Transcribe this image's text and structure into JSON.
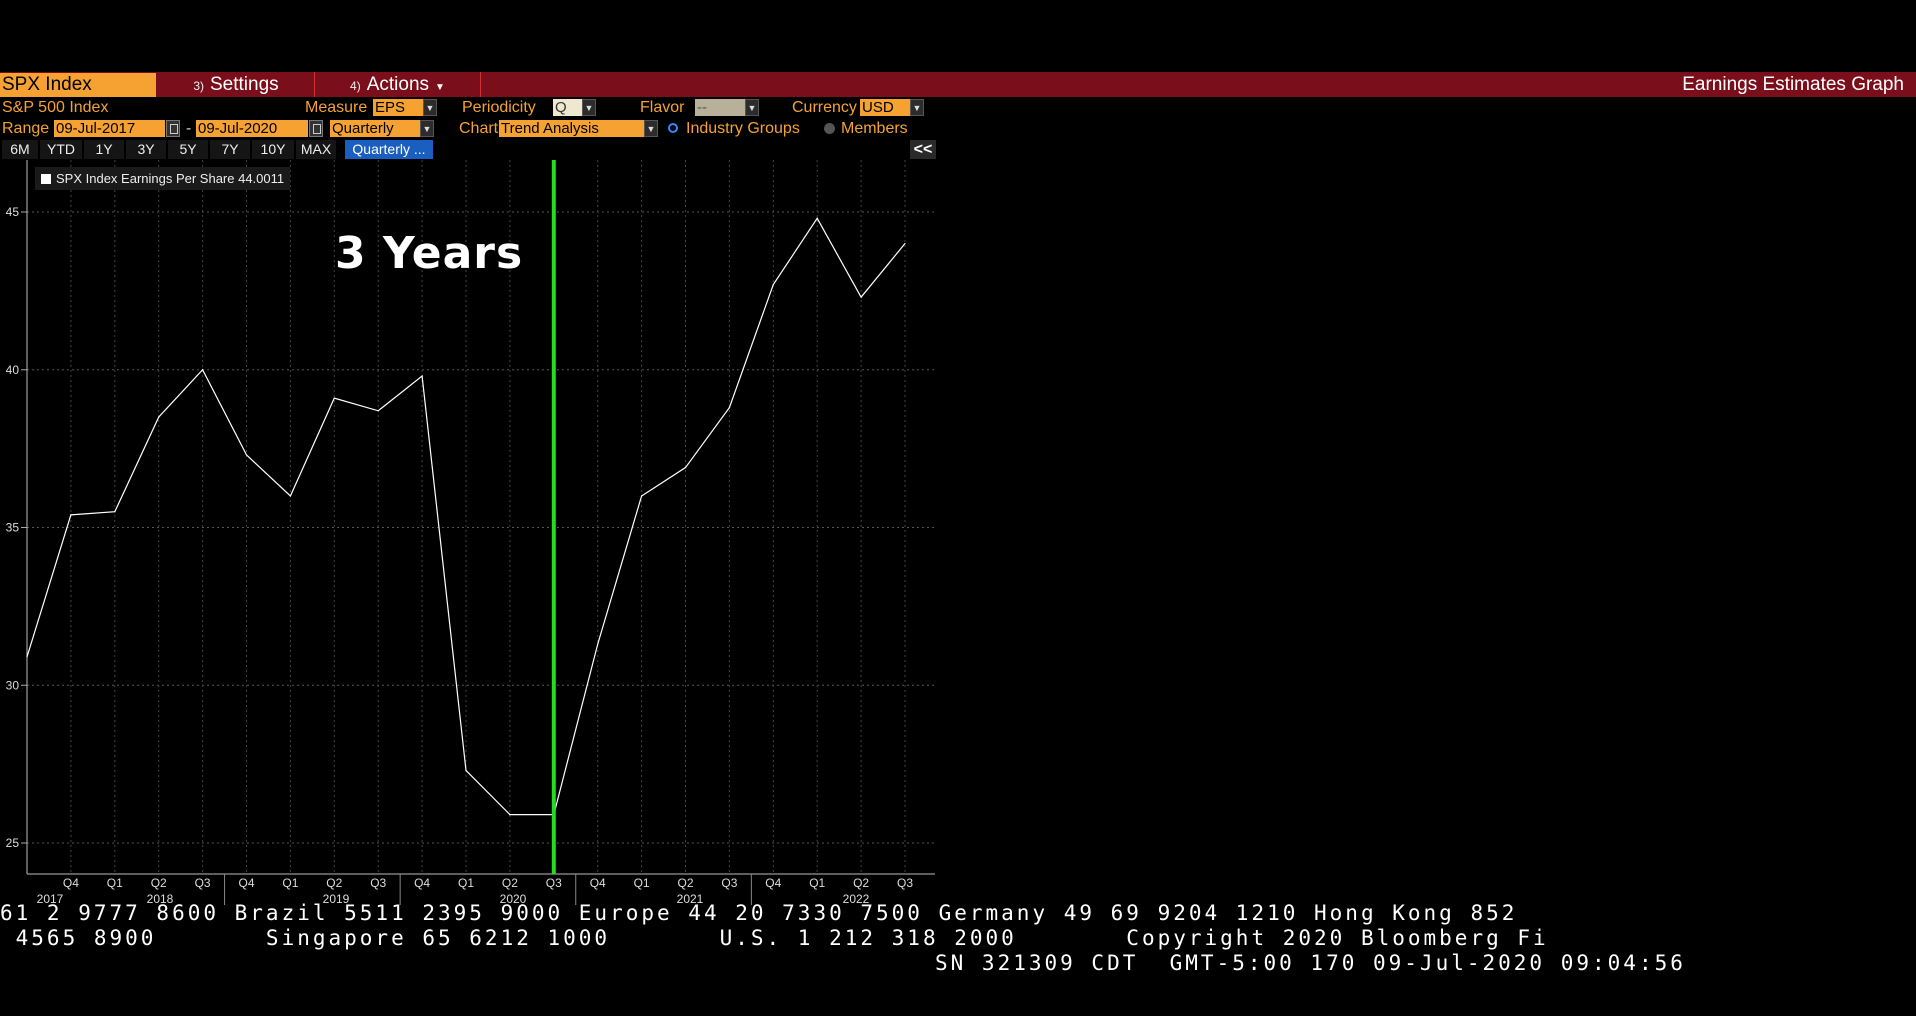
{
  "toolbar": {
    "ticker": "SPX Index",
    "settings": {
      "num": "3)",
      "label": "Settings"
    },
    "actions": {
      "num": "4)",
      "label": "Actions"
    },
    "graph_title": "Earnings Estimates Graph"
  },
  "controls": {
    "security_name": "S&P 500 Index",
    "measure_label": "Measure",
    "measure_value": "EPS",
    "periodicity_label": "Periodicity",
    "periodicity_value": "Q",
    "flavor_label": "Flavor",
    "flavor_value": "--",
    "currency_label": "Currency",
    "currency_value": "USD",
    "range_label": "Range",
    "range_start": "09-Jul-2017",
    "range_sep": "-",
    "range_end": "09-Jul-2020",
    "period_value": "Quarterly",
    "chart_label": "Chart",
    "chart_value": "Trend Analysis",
    "radio_industry": "Industry Groups",
    "radio_members": "Members"
  },
  "zoom_buttons": [
    "6M",
    "YTD",
    "1Y",
    "3Y",
    "5Y",
    "7Y",
    "10Y",
    "MAX"
  ],
  "zoom_active": "Quarterly ...",
  "collapse_label": "<<",
  "legend_text": "SPX Index Earnings Per Share 44.0011",
  "annotation": "3 Years",
  "chart_data": {
    "type": "line",
    "series": [
      {
        "name": "SPX Index Earnings Per Share",
        "x": [
          "Q3 2017",
          "Q4 2017",
          "Q1 2018",
          "Q2 2018",
          "Q3 2018",
          "Q4 2018",
          "Q1 2019",
          "Q2 2019",
          "Q3 2019",
          "Q4 2019",
          "Q1 2020",
          "Q2 2020",
          "Q3 2020",
          "Q4 2020",
          "Q1 2021",
          "Q2 2021",
          "Q3 2021",
          "Q4 2021",
          "Q1 2022",
          "Q2 2022",
          "Q3 2022"
        ],
        "values": [
          30.9,
          35.4,
          35.5,
          38.5,
          40.0,
          37.3,
          36.0,
          39.1,
          38.7,
          39.8,
          27.3,
          25.9,
          25.9,
          31.3,
          36.0,
          36.9,
          38.8,
          42.7,
          44.8,
          42.3,
          44.0
        ]
      }
    ],
    "ylim": [
      24,
      47
    ],
    "yticks": [
      25,
      30,
      35,
      40,
      45
    ],
    "xtick_quarters": [
      "Q4",
      "Q1",
      "Q2",
      "Q3",
      "Q4",
      "Q1",
      "Q2",
      "Q3",
      "Q4",
      "Q1",
      "Q2",
      "Q3",
      "Q4",
      "Q1",
      "Q2",
      "Q3",
      "Q4",
      "Q1",
      "Q2",
      "Q3"
    ],
    "year_labels": [
      "2017",
      "2018",
      "2019",
      "2020",
      "2021",
      "2022"
    ],
    "current_marker": "Q3 2020",
    "marker_color": "#22dd22",
    "line_color": "#ffffff",
    "grid": true
  },
  "footer": {
    "line1": "61 2 9777 8600 Brazil 5511 2395 9000 Europe 44 20 7330 7500 Germany 49 69 9204 1210 Hong Kong 852",
    "line2": " 4565 8900       Singapore 65 6212 1000       U.S. 1 212 318 2000       Copyright 2020 Bloomberg Fi",
    "line3": "SN 321309 CDT  GMT-5:00 170 09-Jul-2020 09:04:56"
  }
}
